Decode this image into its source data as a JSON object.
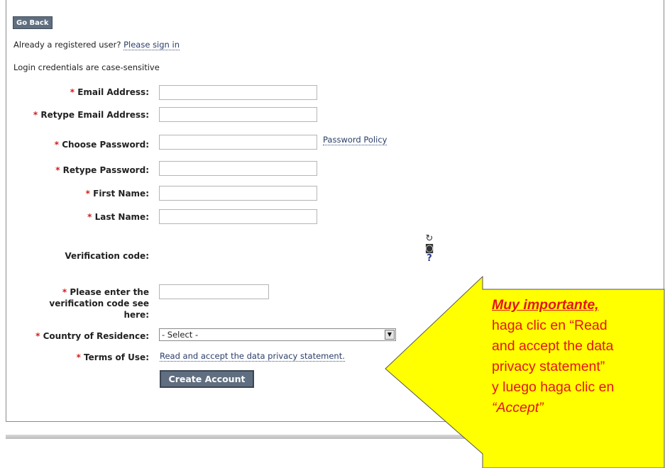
{
  "nav": {
    "go_back": "Go Back"
  },
  "signin": {
    "prompt": "Already a registered user?",
    "link": "Please sign in"
  },
  "note": "Login credentials are case-sensitive",
  "form": {
    "required_mark": "*",
    "email_label": "Email Address:",
    "retype_email_label": "Retype Email Address:",
    "password_label": "Choose Password:",
    "password_policy_link": "Password Policy",
    "retype_password_label": "Retype Password:",
    "first_name_label": "First Name:",
    "last_name_label": "Last Name:",
    "verification_label": "Verification code:",
    "verification_enter_label": "Please enter the verification code see here:",
    "country_label": "Country of Residence:",
    "country_selected": "- Select -",
    "terms_label": "Terms of Use:",
    "terms_link": "Read and accept the data privacy statement.",
    "create_button": "Create Account",
    "values": {
      "email": "",
      "retype_email": "",
      "password": "",
      "retype_password": "",
      "first_name": "",
      "last_name": "",
      "verification": ""
    }
  },
  "captcha_tools": {
    "refresh": "↻",
    "audio": "◙",
    "help": "?"
  },
  "callout": {
    "heading": "Muy importante,",
    "line1": "haga clic en “Read",
    "line2": "and accept the data",
    "line3": "privacy statement”",
    "line4": "y luego haga clic en",
    "line5": "“Accept”",
    "fill_color": "#ffff00",
    "text_color": "#e4141b"
  }
}
